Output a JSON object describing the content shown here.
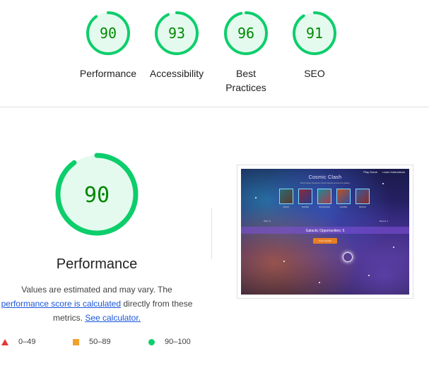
{
  "categories": [
    {
      "id": "performance",
      "score": 90,
      "label": "Performance"
    },
    {
      "id": "accessibility",
      "score": 93,
      "label": "Accessibility"
    },
    {
      "id": "best-practices",
      "score": 96,
      "label": "Best\nPractices"
    },
    {
      "id": "seo",
      "score": 91,
      "label": "SEO"
    }
  ],
  "performance": {
    "score": 90,
    "title": "Performance",
    "desc_1": "Values are estimated and may vary. The",
    "desc_link1": "performance score is calculated",
    "desc_2": " directly from these metrics. ",
    "desc_link2": "See calculator."
  },
  "legend": [
    {
      "shape": "triangle",
      "range": "0–49",
      "color": "#e53935"
    },
    {
      "shape": "square",
      "range": "50–89",
      "color": "#f2a02c"
    },
    {
      "shape": "circle",
      "range": "90–100",
      "color": "#0cce6b"
    }
  ],
  "screenshot": {
    "title": "Cosmic Clash",
    "subtitle": "Rock Paper Scissors Lizard Spock across the galaxy",
    "nav_items": [
      "Play Game",
      "Learn Instructions"
    ],
    "cards": [
      "ROCK",
      "PAPER",
      "SCISSORS",
      "LIZARD",
      "SPOCK"
    ],
    "round_left": "Wins: 0",
    "round_right": "Round: 1",
    "band_text": "Galactic Opportunities: 5",
    "button_text": "PLAY AGAIN"
  },
  "colors": {
    "pass": "#0cce6b",
    "pass_bg": "#e5faef",
    "pass_text": "#008800",
    "average": "#f2a02c",
    "fail": "#e53935",
    "link": "#1a56db"
  }
}
